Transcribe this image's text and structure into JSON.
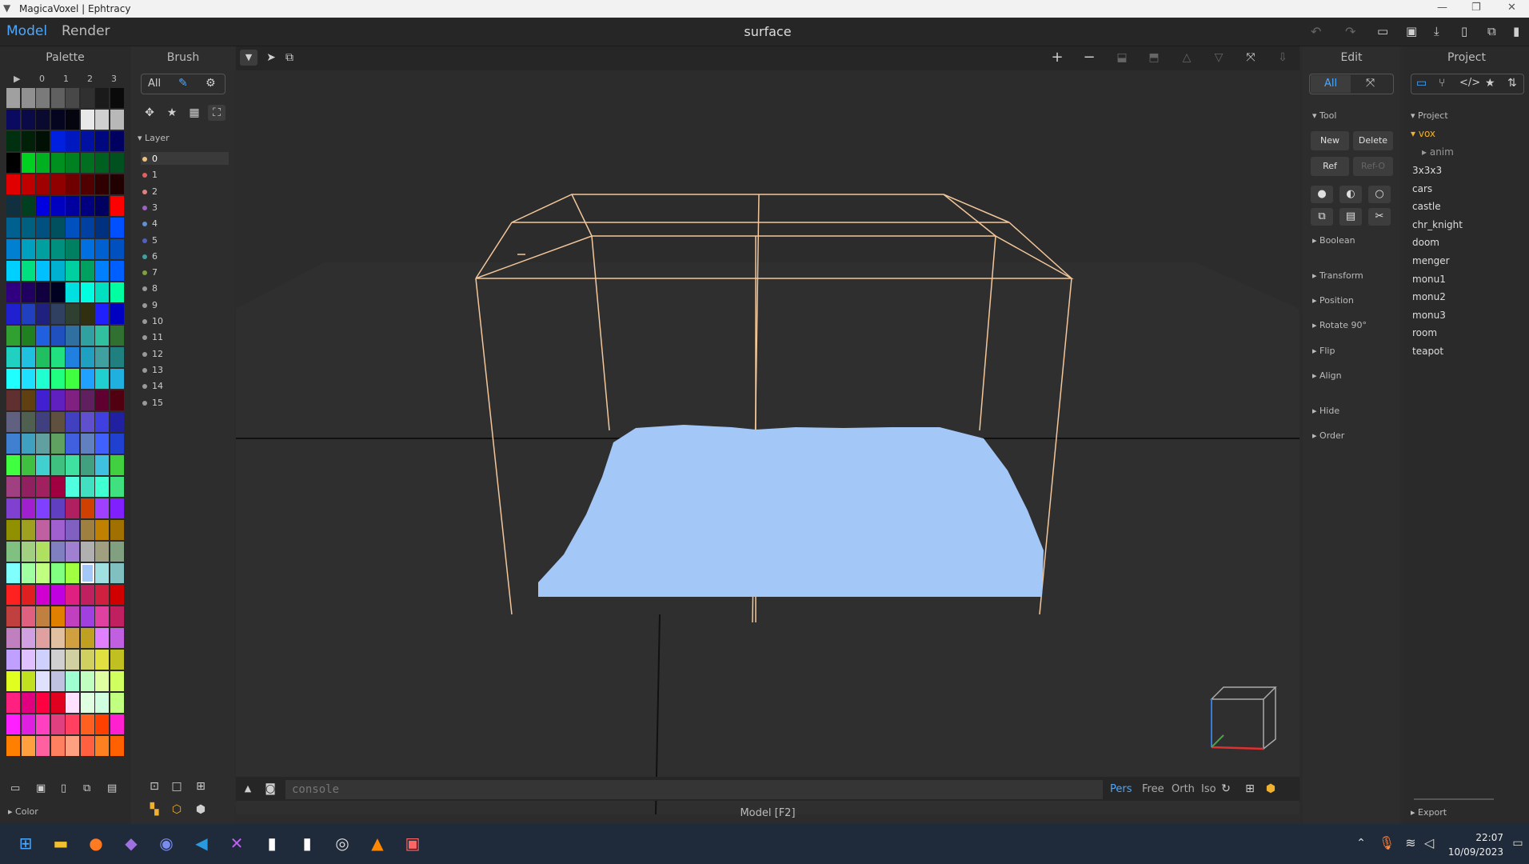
{
  "window": {
    "title": "MagicaVoxel | Ephtracy",
    "min_label": "—",
    "max_label": "❐",
    "close_label": "✕"
  },
  "menu": {
    "model_tab": "Model",
    "render_tab": "Render",
    "document_title": "surface"
  },
  "palette": {
    "title": "Palette",
    "columns": [
      "▶",
      "0",
      "1",
      "2",
      "3"
    ],
    "color_section": "Color",
    "selected_color": "#a3c8f8"
  },
  "brush": {
    "title": "Brush",
    "all_label": "All",
    "layer_section": "Layer",
    "selected_layer": "0",
    "layers": [
      {
        "label": "0",
        "color": "#f0c080"
      },
      {
        "label": "1",
        "color": "#e06060"
      },
      {
        "label": "2",
        "color": "#e08080"
      },
      {
        "label": "3",
        "color": "#a060c0"
      },
      {
        "label": "4",
        "color": "#6090d0"
      },
      {
        "label": "5",
        "color": "#5060c0"
      },
      {
        "label": "6",
        "color": "#40a0a0"
      },
      {
        "label": "7",
        "color": "#80a040"
      },
      {
        "label": "8",
        "color": "#999999"
      },
      {
        "label": "9",
        "color": "#999999"
      },
      {
        "label": "10",
        "color": "#999999"
      },
      {
        "label": "11",
        "color": "#999999"
      },
      {
        "label": "12",
        "color": "#999999"
      },
      {
        "label": "13",
        "color": "#999999"
      },
      {
        "label": "14",
        "color": "#999999"
      },
      {
        "label": "15",
        "color": "#999999"
      }
    ]
  },
  "viewport": {
    "console_placeholder": "console",
    "cameras": [
      "Pers",
      "Free",
      "Orth",
      "Iso"
    ],
    "active_camera": "Pers",
    "status": "Model [F2]",
    "model_color": "#a3c8f8",
    "bbox_color": "#f3c79a"
  },
  "edit": {
    "title": "Edit",
    "all_label": "All",
    "tool_section": "Tool",
    "new_label": "New",
    "delete_label": "Delete",
    "ref_label": "Ref",
    "refo_label": "Ref-O",
    "sections": [
      "Boolean",
      "Transform",
      "Position",
      "Rotate 90°",
      "Flip",
      "Align",
      "Hide",
      "Order"
    ]
  },
  "project": {
    "title": "Project",
    "section": "Project",
    "folder": "vox",
    "subfolder": "anim",
    "items": [
      "3x3x3",
      "cars",
      "castle",
      "chr_knight",
      "doom",
      "menger",
      "monu1",
      "monu2",
      "monu3",
      "room",
      "teapot"
    ],
    "export_label": "Export"
  },
  "taskbar": {
    "time": "22:07",
    "date": "10/09/2023"
  }
}
